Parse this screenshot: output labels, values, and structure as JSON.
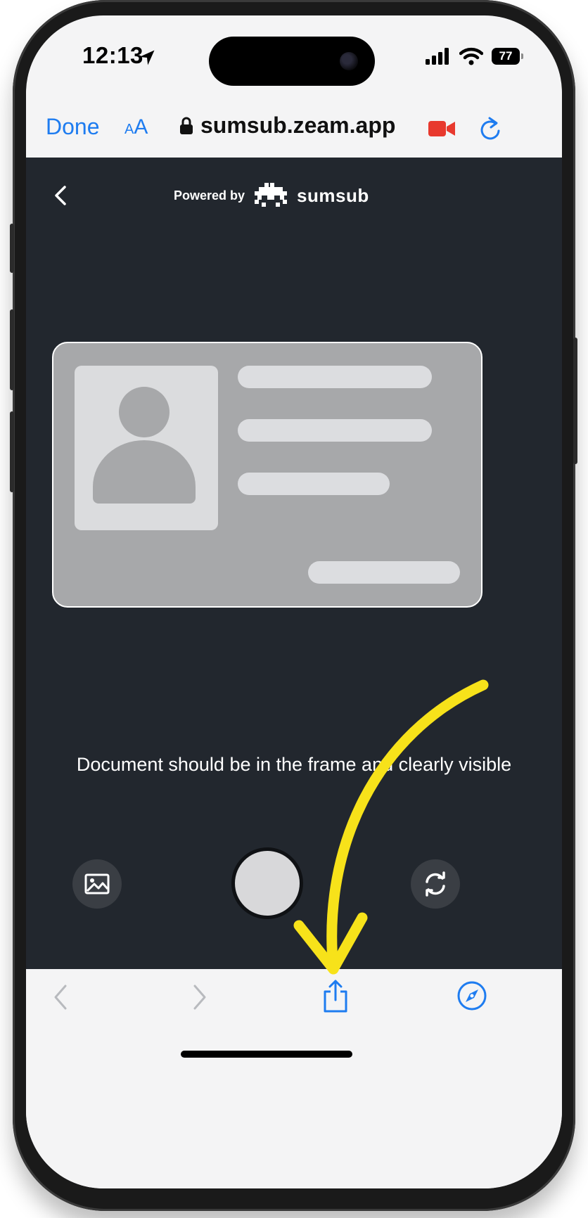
{
  "status_bar": {
    "time": "12:13",
    "battery": "77"
  },
  "browser": {
    "done_label": "Done",
    "aa_small": "A",
    "aa_large": "A",
    "url": "sumsub.zeam.app"
  },
  "page": {
    "powered_by": "Powered by",
    "brand": "sumsub",
    "instruction": "Document should be in the frame and clearly visible"
  },
  "colors": {
    "accent": "#1e7cf0",
    "page_bg": "#22272e",
    "annotation_arrow": "#f7e21a",
    "record_indicator": "#e8392e"
  },
  "icons": {
    "status": [
      "location-arrow-icon",
      "signal-icon",
      "wifi-icon",
      "battery-icon"
    ],
    "browser": [
      "lock-icon",
      "video-record-icon",
      "reload-icon"
    ],
    "page": [
      "back-chevron-icon",
      "sumsub-logo-icon",
      "gallery-icon",
      "switch-camera-icon"
    ],
    "toolbar": [
      "back-icon",
      "forward-icon",
      "share-icon",
      "compass-icon"
    ]
  }
}
